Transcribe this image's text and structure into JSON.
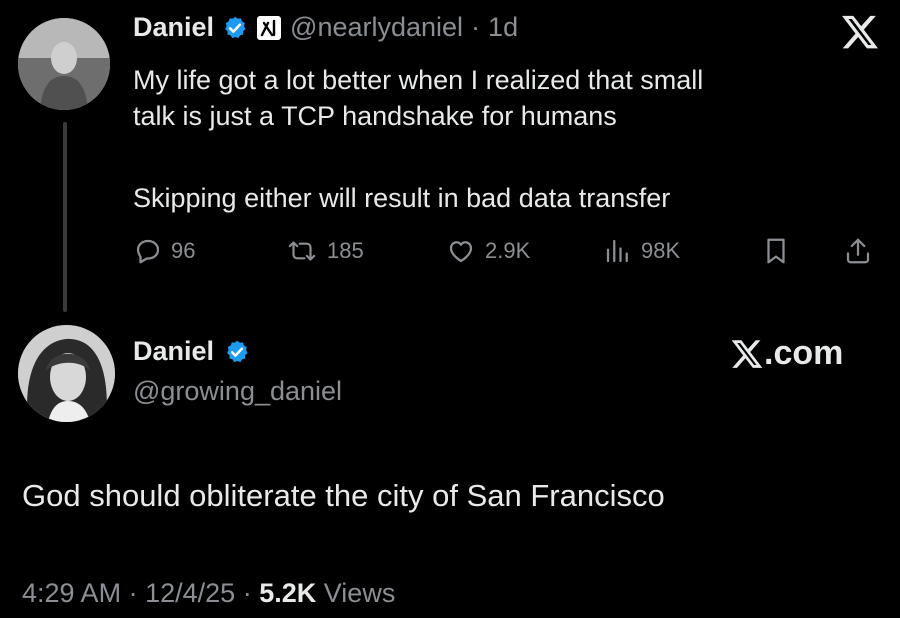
{
  "quoted_tweet": {
    "author_name": "Daniel",
    "handle": "@nearlydaniel",
    "separator": "·",
    "time_ago": "1d",
    "text_line1": "My life got a lot better when I realized that small",
    "text_line2": "talk is just a TCP handshake for humans",
    "text_line3": "Skipping either will result in bad data transfer",
    "actions": {
      "replies": "96",
      "reposts": "185",
      "likes": "2.9K",
      "views": "98K"
    }
  },
  "main_tweet": {
    "author_name": "Daniel",
    "handle": "@growing_daniel",
    "site_label": ".com",
    "text": "God should obliterate the city of San Francisco",
    "time": "4:29 AM",
    "separator": "·",
    "date": "12/4/25",
    "views_count": "5.2K",
    "views_label": "Views"
  },
  "colors": {
    "background": "#000000",
    "text": "#e7e9ea",
    "secondary": "#8b8f94",
    "verified": "#1d9bf0"
  },
  "icons": [
    "verified-badge-icon",
    "xai-badge-icon",
    "x-logo-icon",
    "reply-icon",
    "repost-icon",
    "like-icon",
    "views-icon",
    "bookmark-icon",
    "share-icon"
  ]
}
